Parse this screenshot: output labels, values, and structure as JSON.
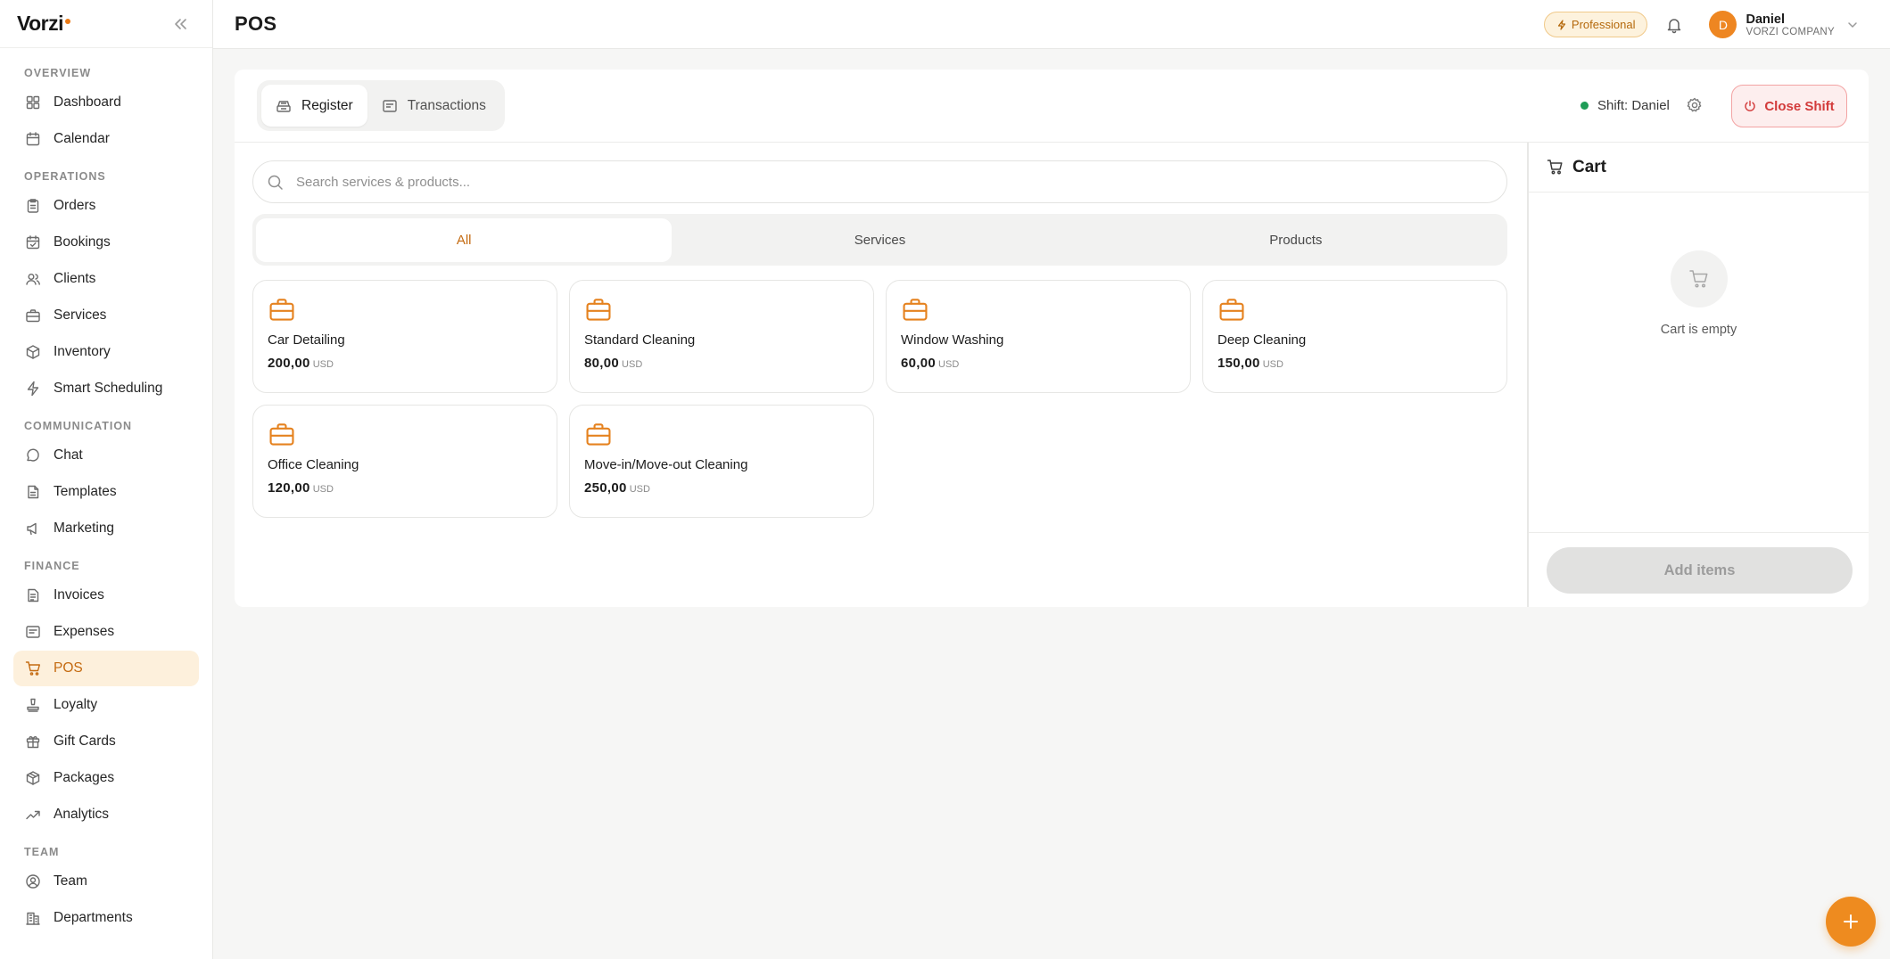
{
  "app": {
    "logo": "Vorzi",
    "page_title": "POS"
  },
  "header": {
    "plan_badge": "Professional",
    "user": {
      "initial": "D",
      "name": "Daniel",
      "company": "VORZI COMPANY"
    }
  },
  "sidebar": {
    "sections": [
      {
        "label": "OVERVIEW",
        "items": [
          {
            "label": "Dashboard",
            "icon": "dashboard-icon"
          },
          {
            "label": "Calendar",
            "icon": "calendar-icon"
          }
        ]
      },
      {
        "label": "OPERATIONS",
        "items": [
          {
            "label": "Orders",
            "icon": "clipboard-icon"
          },
          {
            "label": "Bookings",
            "icon": "calendar-check-icon"
          },
          {
            "label": "Clients",
            "icon": "users-icon"
          },
          {
            "label": "Services",
            "icon": "briefcase-icon"
          },
          {
            "label": "Inventory",
            "icon": "box-icon"
          },
          {
            "label": "Smart Scheduling",
            "icon": "zap-icon"
          }
        ]
      },
      {
        "label": "COMMUNICATION",
        "items": [
          {
            "label": "Chat",
            "icon": "chat-icon"
          },
          {
            "label": "Templates",
            "icon": "template-icon"
          },
          {
            "label": "Marketing",
            "icon": "megaphone-icon"
          }
        ]
      },
      {
        "label": "FINANCE",
        "items": [
          {
            "label": "Invoices",
            "icon": "invoice-icon"
          },
          {
            "label": "Expenses",
            "icon": "receipt-icon"
          },
          {
            "label": "POS",
            "icon": "cart-icon",
            "active": true
          },
          {
            "label": "Loyalty",
            "icon": "stamp-icon"
          },
          {
            "label": "Gift Cards",
            "icon": "gift-icon"
          },
          {
            "label": "Packages",
            "icon": "package-icon"
          },
          {
            "label": "Analytics",
            "icon": "trend-icon"
          }
        ]
      },
      {
        "label": "TEAM",
        "items": [
          {
            "label": "Team",
            "icon": "user-circle-icon"
          },
          {
            "label": "Departments",
            "icon": "building-icon"
          }
        ]
      }
    ]
  },
  "pos": {
    "tabs": [
      {
        "label": "Register",
        "icon": "register-icon",
        "active": true
      },
      {
        "label": "Transactions",
        "icon": "receipt-icon"
      }
    ],
    "shift_label": "Shift: Daniel",
    "close_shift_label": "Close Shift",
    "search_placeholder": "Search services & products...",
    "filters": [
      {
        "label": "All",
        "active": true
      },
      {
        "label": "Services"
      },
      {
        "label": "Products"
      }
    ],
    "items": [
      {
        "name": "Car Detailing",
        "price": "200,00",
        "currency": "USD",
        "icon": "briefcase-icon"
      },
      {
        "name": "Standard Cleaning",
        "price": "80,00",
        "currency": "USD",
        "icon": "briefcase-icon"
      },
      {
        "name": "Window Washing",
        "price": "60,00",
        "currency": "USD",
        "icon": "briefcase-icon"
      },
      {
        "name": "Deep Cleaning",
        "price": "150,00",
        "currency": "USD",
        "icon": "briefcase-icon"
      },
      {
        "name": "Office Cleaning",
        "price": "120,00",
        "currency": "USD",
        "icon": "briefcase-icon"
      },
      {
        "name": "Move-in/Move-out Cleaning",
        "price": "250,00",
        "currency": "USD",
        "icon": "briefcase-icon"
      }
    ],
    "cart": {
      "title": "Cart",
      "empty_text": "Cart is empty",
      "add_items_label": "Add items"
    }
  },
  "colors": {
    "accent": "#ee8b1f",
    "danger": "#d33b3b",
    "status_online": "#1f9d57"
  }
}
